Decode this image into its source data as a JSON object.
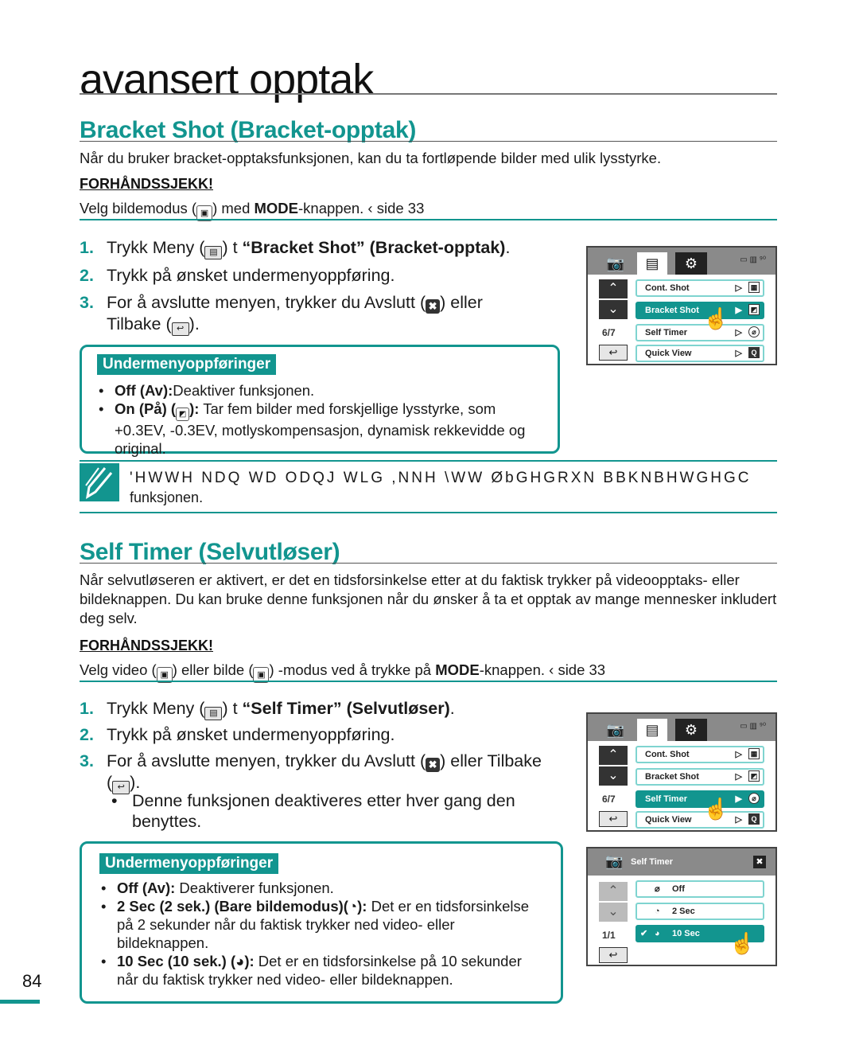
{
  "chapter": {
    "title": "avansert opptak"
  },
  "page_number": "84",
  "bracket": {
    "title": "Bracket Shot (Bracket-opptak)",
    "intro": "Når du bruker bracket-opptaksfunksjonen, kan du ta fortløpende bilder med ulik lysstyrke.",
    "precheck_title": "FORHÅNDSSJEKK!",
    "precheck_pre": "Velg bildemodus (",
    "precheck_post": ") med ",
    "precheck_bold": "MODE",
    "precheck_end": "-knappen.  ‹ side 33",
    "steps": [
      {
        "num": "1.",
        "pre": "Trykk Meny (",
        "post": ")  t ",
        "bold": "“Bracket Shot” (Bracket-opptak)",
        "end": "."
      },
      {
        "num": "2.",
        "text": "Trykk på ønsket undermenyoppføring."
      },
      {
        "num": "3.",
        "pre": "For å avslutte menyen, trykker du Avslutt (",
        "post": ") eller",
        "line2_pre": "Tilbake (",
        "line2_end": ")."
      }
    ],
    "submenu": {
      "title": "Undermenyoppføringer",
      "items": [
        {
          "bold": "Off (Av):",
          "text": "Deaktiver funksjonen."
        },
        {
          "bold": "On (På) (",
          "bold_end": "):",
          "text": " Tar fem bilder med forskjellige lysstyrke, som +0.3EV, -0.3EV, motlyskompensasjon, dynamisk rekkevidde og original."
        }
      ]
    },
    "screen": {
      "page_indicator": "6/7",
      "items": [
        "Cont. Shot",
        "Bracket Shot",
        "Self Timer",
        "Quick View"
      ],
      "selected": "Bracket Shot"
    },
    "note": {
      "line1": "'HWWH NDQ WD ODQJ WLG  ,NNH  \\WW ØbGHGRXN BBKNBHWGHGC",
      "line2": "funksjonen."
    }
  },
  "selftimer": {
    "title": "Self Timer (Selvutløser)",
    "intro": "Når selvutløseren er aktivert, er det en tidsforsinkelse etter at du faktisk trykker på videoopptaks- eller bildeknappen. Du kan bruke denne funksjonen når du ønsker å ta et opptak av mange mennesker inkludert deg selv.",
    "precheck_title": "FORHÅNDSSJEKK!",
    "precheck_pre": "Velg video (",
    "precheck_mid": ") eller bilde (",
    "precheck_post": ") -modus ved å trykke på ",
    "precheck_bold": "MODE",
    "precheck_end": "-knappen.  ‹ side 33",
    "steps": [
      {
        "num": "1.",
        "pre": "Trykk Meny (",
        "post": ")  t ",
        "bold": "“Self Timer” (Selvutløser)",
        "end": "."
      },
      {
        "num": "2.",
        "text": "Trykk på ønsket undermenyoppføring."
      },
      {
        "num": "3.",
        "pre": "For å avslutte menyen, trykker du Avslutt (",
        "post": ") eller Tilbake",
        "line2_pre": "(",
        "line2_end": ")."
      }
    ],
    "bullet": "Denne funksjonen deaktiveres etter hver gang den benyttes.",
    "submenu": {
      "title": "Undermenyoppføringer",
      "items": [
        {
          "bold": "Off (Av):",
          "text": " Deaktiverer funksjonen."
        },
        {
          "bold": "2 Sec (2 sek.) (Bare bildemodus)(",
          "bold_end": "):",
          "text": " Det er en tidsforsinkelse på 2 sekunder når du faktisk trykker ned video- eller bildeknappen."
        },
        {
          "bold": "10 Sec (10 sek.) (",
          "bold_end": "):",
          "text": " Det er en tidsforsinkelse på 10 sekunder når du faktisk trykker ned video- eller bildeknappen."
        }
      ]
    },
    "screen_menu": {
      "page_indicator": "6/7",
      "items": [
        "Cont. Shot",
        "Bracket Shot",
        "Self Timer",
        "Quick View"
      ],
      "selected": "Self Timer"
    },
    "screen_sub": {
      "title": "Self Timer",
      "page_indicator": "1/1",
      "options": [
        "Off",
        "2 Sec",
        "10 Sec"
      ],
      "selected": "10 Sec"
    }
  },
  "icons": {
    "camera": "📷",
    "menu": "▤",
    "gear": "⚙",
    "up": "⌃",
    "down": "⌄",
    "back": "↩",
    "close": "✖",
    "arrow": "▷",
    "check": "✔",
    "hand": "☝",
    "mode": "🎥"
  },
  "colors": {
    "accent": "#12958f"
  }
}
